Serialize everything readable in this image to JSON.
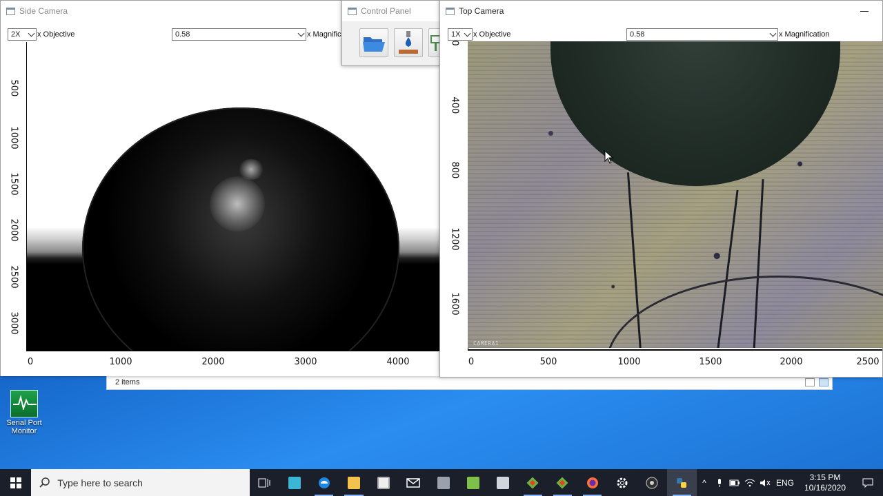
{
  "side_camera": {
    "title": "Side Camera",
    "objective_value": "2X",
    "objective_label": "x Objective",
    "magnification_value": "0.58",
    "magnification_label": "x Magnifica",
    "y_ticks": [
      "500",
      "1000",
      "1500",
      "2000",
      "2500",
      "3000"
    ],
    "x_ticks": [
      "0",
      "1000",
      "2000",
      "3000",
      "4000"
    ]
  },
  "control_panel": {
    "title": "Control Panel",
    "buttons": [
      "folder-open",
      "droplet-dispense",
      "stage"
    ]
  },
  "top_camera": {
    "title": "Top Camera",
    "objective_value": "1X",
    "objective_label": "x Objective",
    "magnification_value": "0.58",
    "magnification_label": "x Magnification",
    "y_ticks": [
      "0",
      "400",
      "800",
      "1200",
      "1600"
    ],
    "x_ticks": [
      "0",
      "500",
      "1000",
      "1500",
      "2000",
      "2500"
    ],
    "camera_overlay": "CAMERA1"
  },
  "explorer": {
    "item_count": "2 items"
  },
  "desktop": {
    "icon_label": "Serial Port Monitor"
  },
  "taskbar": {
    "search_placeholder": "Type here to search",
    "language": "ENG",
    "time": "3:15 PM",
    "date": "10/16/2020",
    "apps": [
      "task-view",
      "3d-app",
      "edge",
      "file-explorer",
      "store",
      "mail",
      "app-gray",
      "notepad-green",
      "app-window",
      "git-diamond",
      "git-diamond-2",
      "firefox",
      "settings",
      "obs",
      "python"
    ]
  }
}
